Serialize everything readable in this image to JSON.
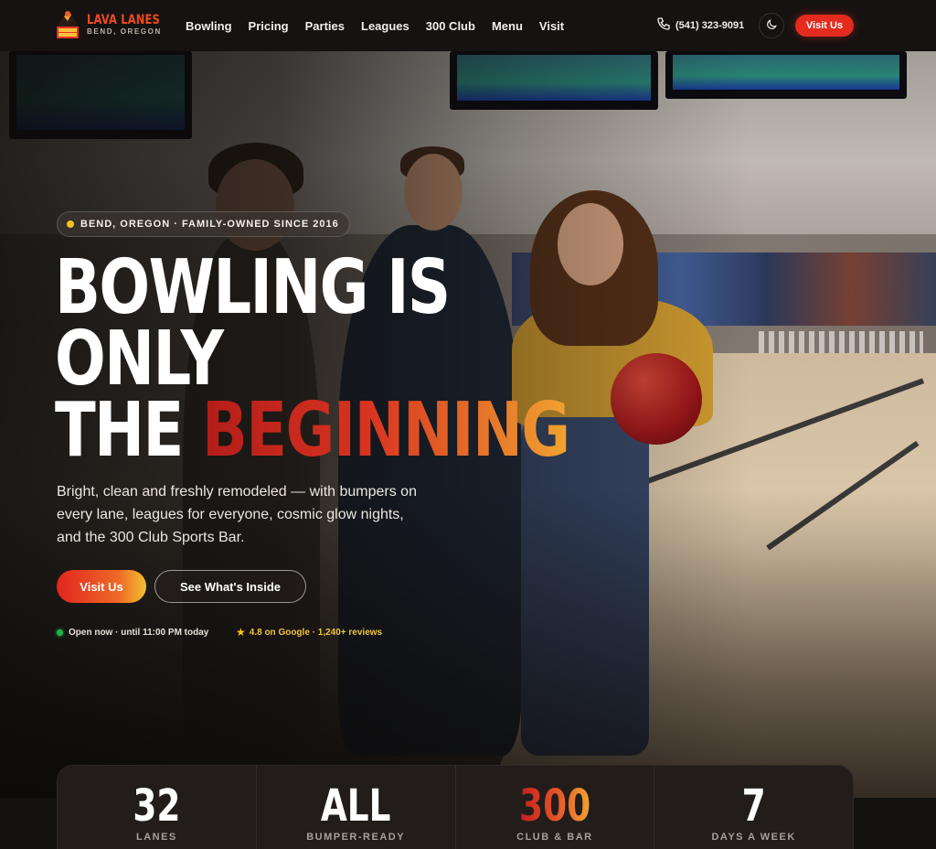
{
  "brand": {
    "name": "LAVA LANES",
    "city": "BEND, OREGON",
    "mark_text": "LAVA LANES"
  },
  "nav": {
    "links": [
      "Bowling",
      "Pricing",
      "Parties",
      "Leagues",
      "300 Club",
      "Menu",
      "Visit"
    ],
    "phone": "(541) 323-9091",
    "cta_label": "Visit Us",
    "theme_icon": "moon-icon",
    "phone_icon": "phone-icon"
  },
  "hero": {
    "badge": "BEND, OREGON · FAMILY-OWNED SINCE 2016",
    "headline_line1": "BOWLING IS",
    "headline_line2": "ONLY",
    "headline_line3_plain": "THE ",
    "headline_line3_accent": "BEGINNING",
    "subcopy": "Bright, clean and freshly remodeled — with bumpers on every lane, leagues for everyone, cosmic glow nights, and the 300 Club Sports Bar.",
    "primary_cta": "Visit Us",
    "secondary_cta": "See What's Inside",
    "status": "Open now · until 11:00 PM today",
    "rating": "4.8 on Google · 1,240+ reviews"
  },
  "stats": [
    {
      "value": "32",
      "label": "LANES"
    },
    {
      "value": "ALL",
      "label": "BUMPER-READY"
    },
    {
      "value": "300",
      "label": "CLUB & BAR"
    },
    {
      "value": "7",
      "label": "DAYS A WEEK"
    }
  ],
  "colors": {
    "accent_red": "#e32c1e",
    "accent_orange": "#f0a331",
    "open_green": "#23b34a",
    "star_yellow": "#f5c51d",
    "bg_dark": "#141111"
  }
}
